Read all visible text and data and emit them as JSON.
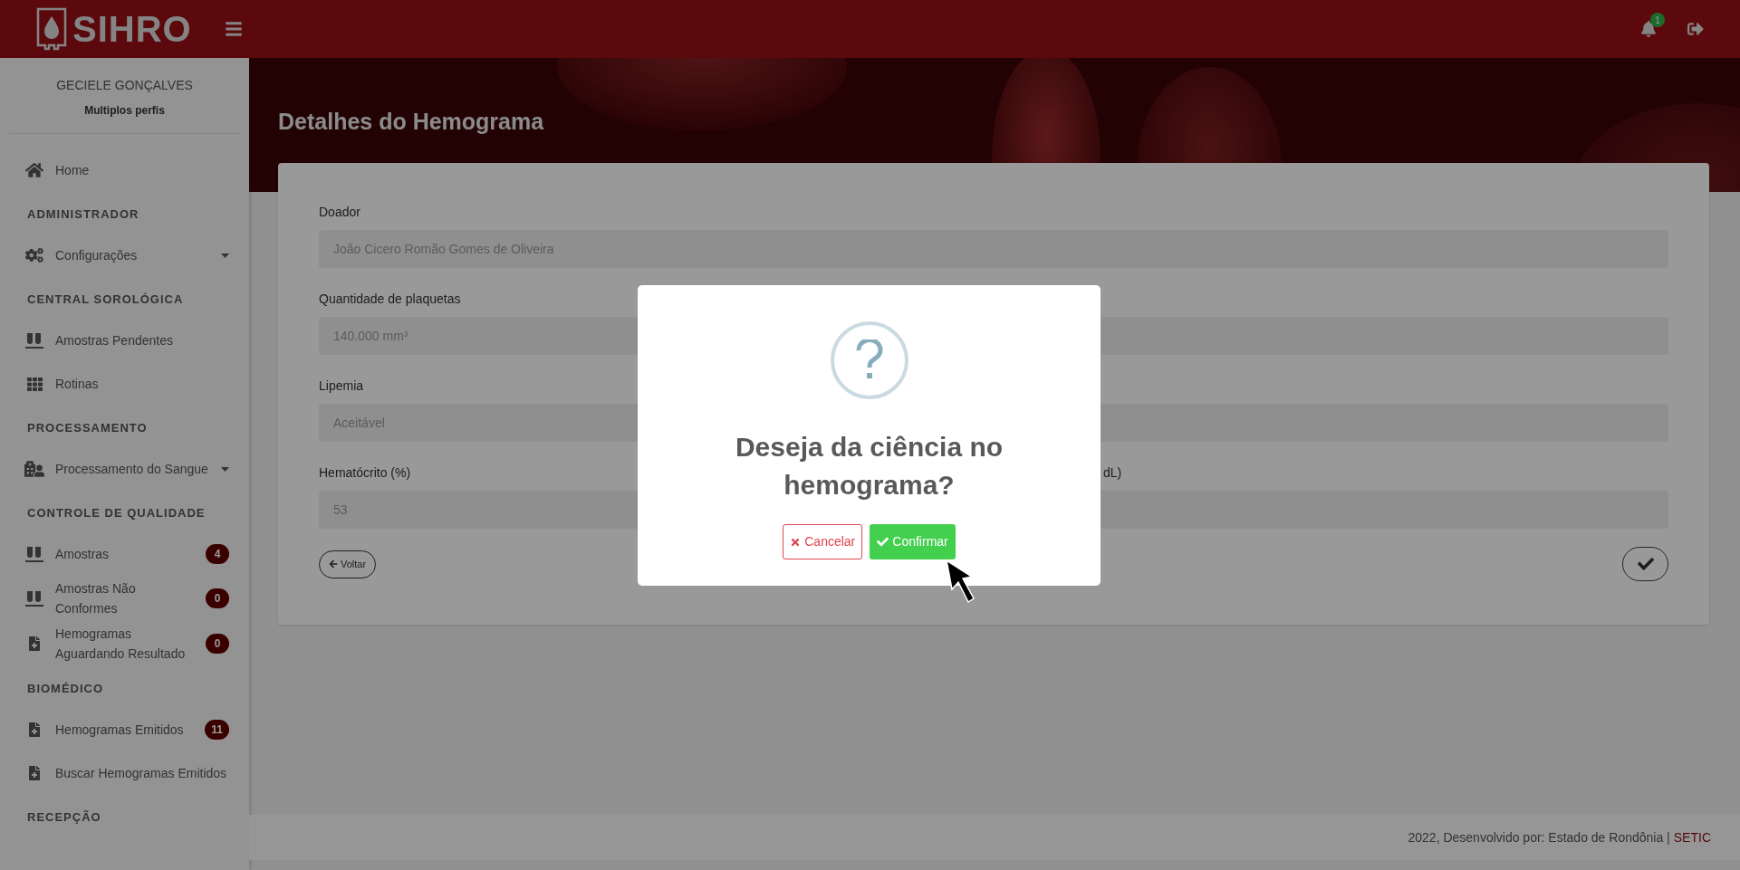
{
  "header": {
    "logo_text": "SIHRO",
    "notification_count": "1"
  },
  "sidebar": {
    "user_name": "GECIELE GONÇALVES",
    "profile": "Multiplos perfis",
    "items": [
      {
        "kind": "link",
        "label": "Home"
      },
      {
        "kind": "section",
        "label": "ADMINISTRADOR"
      },
      {
        "kind": "dropdown",
        "label": "Configurações"
      },
      {
        "kind": "section",
        "label": "CENTRAL SOROLÓGICA"
      },
      {
        "kind": "link",
        "label": "Amostras Pendentes"
      },
      {
        "kind": "link",
        "label": "Rotinas"
      },
      {
        "kind": "section",
        "label": "PROCESSAMENTO"
      },
      {
        "kind": "dropdown",
        "label": "Processamento do Sangue"
      },
      {
        "kind": "section",
        "label": "CONTROLE DE QUALIDADE"
      },
      {
        "kind": "link",
        "label": "Amostras",
        "badge": "4"
      },
      {
        "kind": "link",
        "label": "Amostras Não Conformes",
        "badge": "0"
      },
      {
        "kind": "link",
        "label": "Hemogramas Aguardando Resultado",
        "badge": "0"
      },
      {
        "kind": "section",
        "label": "BIOMÉDICO"
      },
      {
        "kind": "link",
        "label": "Hemogramas Emitidos",
        "badge": "11"
      },
      {
        "kind": "link",
        "label": "Buscar Hemogramas Emitidos"
      },
      {
        "kind": "section",
        "label": "RECEPÇÃO"
      }
    ]
  },
  "page_title": "Detalhes do Hemograma",
  "form": {
    "fields": [
      {
        "label": "Doador",
        "value": "João Cicero Romão Gomes de Oliveira"
      },
      {
        "label": "Quantidade de plaquetas",
        "value": "140.000 mm³"
      },
      {
        "label": "Lipemia",
        "value": "Aceitável"
      }
    ],
    "columns": [
      {
        "label": "Hematócrito (%)",
        "value": "53"
      },
      {
        "label": "dL)"
      }
    ],
    "back_button": "Voltar"
  },
  "modal": {
    "title": "Deseja da ciência no hemograma?",
    "buttons": [
      {
        "kind": "cancel",
        "label": "Cancelar"
      },
      {
        "kind": "confirm",
        "label": "Confirmar"
      }
    ]
  },
  "footer": {
    "text": "2022, Desenvolvido por: Estado de Rondônia |",
    "link": "SETIC"
  }
}
